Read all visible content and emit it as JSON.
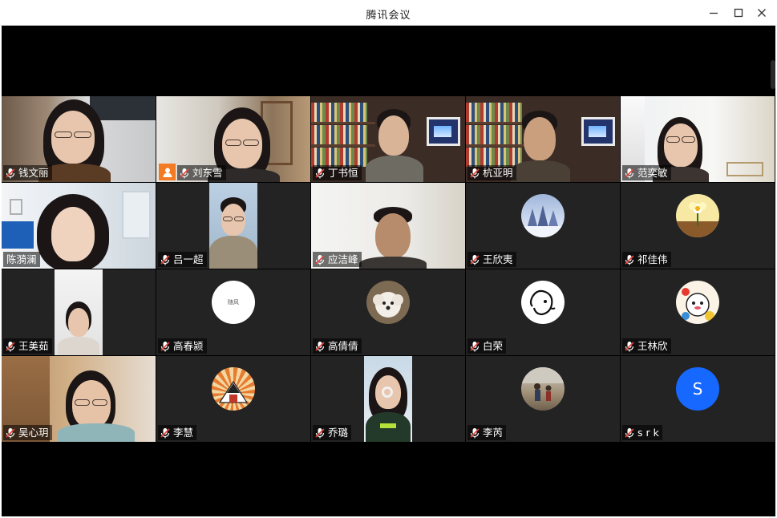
{
  "window": {
    "title": "腾讯会议",
    "controls": [
      "minimize-icon",
      "maximize-icon",
      "close-icon"
    ]
  },
  "participants": [
    {
      "name": "钱文丽",
      "muted": true,
      "video": "camera"
    },
    {
      "name": "刘东雪",
      "muted": true,
      "video": "camera",
      "host_badge": "person-icon"
    },
    {
      "name": "丁书恒",
      "muted": true,
      "video": "camera"
    },
    {
      "name": "杭亚明",
      "muted": true,
      "video": "camera"
    },
    {
      "name": "范奕敏",
      "muted": true,
      "video": "camera"
    },
    {
      "name": "陈漪澜",
      "muted": false,
      "video": "camera"
    },
    {
      "name": "吕一超",
      "muted": true,
      "video": "camera"
    },
    {
      "name": "应洁峰",
      "muted": true,
      "video": "camera"
    },
    {
      "name": "王欣夷",
      "muted": true,
      "video": "avatar"
    },
    {
      "name": "祁佳伟",
      "muted": true,
      "video": "avatar"
    },
    {
      "name": "王美茹",
      "muted": true,
      "video": "camera"
    },
    {
      "name": "高春颍",
      "muted": true,
      "video": "avatar",
      "avatar_text": "随风"
    },
    {
      "name": "高倩倩",
      "muted": true,
      "video": "avatar"
    },
    {
      "name": "白荣",
      "muted": true,
      "video": "avatar"
    },
    {
      "name": "王林欣",
      "muted": true,
      "video": "avatar"
    },
    {
      "name": "吴心玥",
      "muted": true,
      "video": "camera"
    },
    {
      "name": "李慧",
      "muted": true,
      "video": "avatar"
    },
    {
      "name": "乔璐",
      "muted": true,
      "video": "camera"
    },
    {
      "name": "李芮",
      "muted": true,
      "video": "avatar"
    },
    {
      "name": "s r k",
      "muted": true,
      "video": "avatar",
      "avatar_text": "S"
    }
  ],
  "colors": {
    "stage": "#000000",
    "tile": "#232323",
    "host_badge": "#f27b23",
    "letter_avatar": "#1668ff",
    "muted_mic": "#e5413b"
  }
}
